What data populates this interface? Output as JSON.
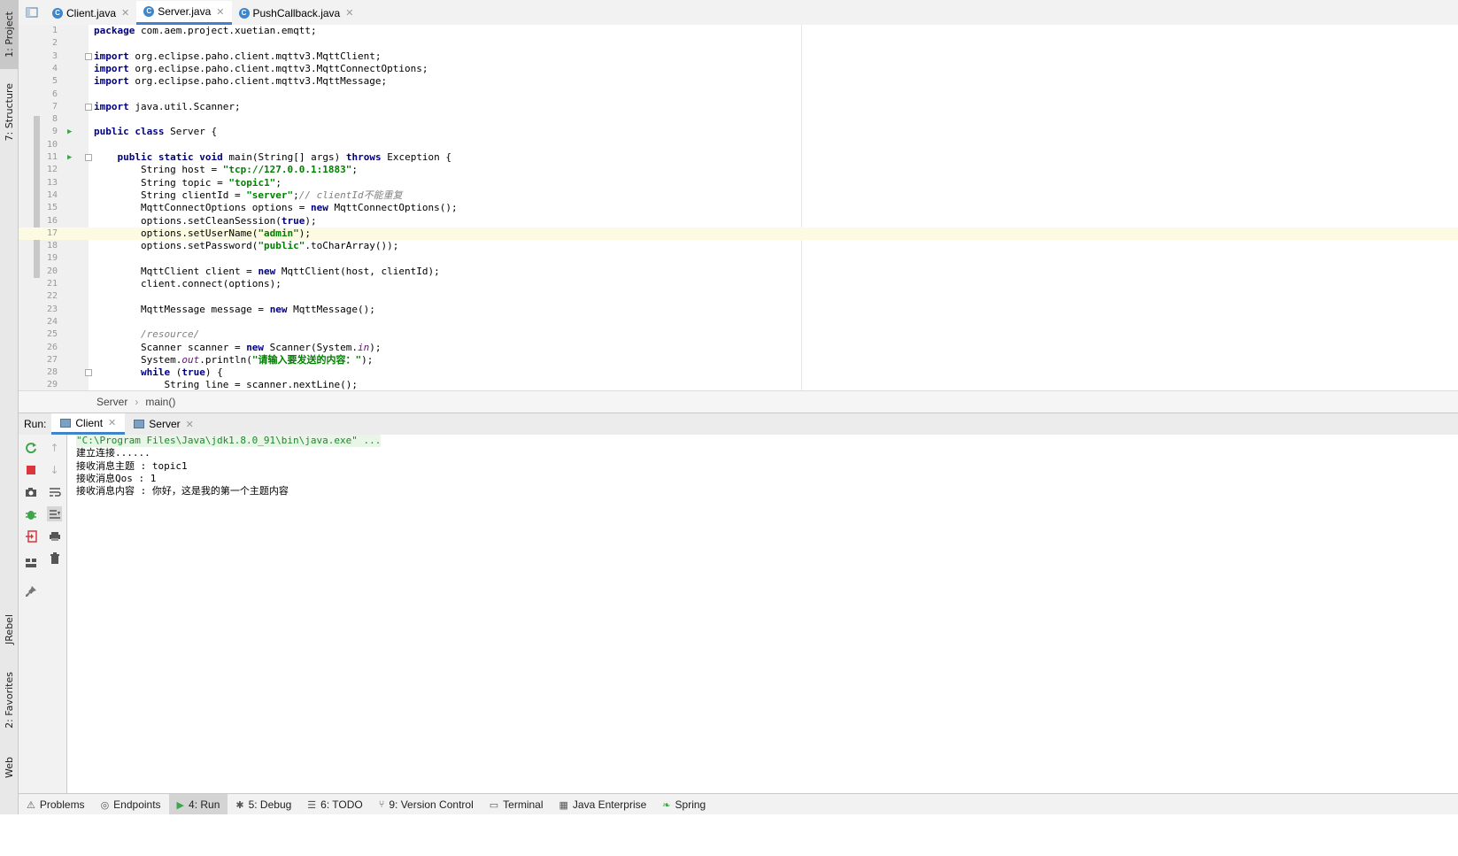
{
  "left_tool_tabs": [
    {
      "label": "1: Project",
      "icon": "folder-icon"
    },
    {
      "label": "7: Structure",
      "icon": "structure-icon"
    },
    {
      "label": "JRebel",
      "icon": "jrebel-icon"
    },
    {
      "label": "2: Favorites",
      "icon": "star-icon"
    },
    {
      "label": "Web",
      "icon": "globe-icon"
    }
  ],
  "editor_tabs": [
    {
      "label": "Client.java",
      "icon": "class-icon"
    },
    {
      "label": "Server.java",
      "icon": "class-icon",
      "active": true
    },
    {
      "label": "PushCallback.java",
      "icon": "class-icon"
    }
  ],
  "code_lines": [
    {
      "n": "1",
      "text": "package com.aem.project.xuetian.emqtt;"
    },
    {
      "n": "2",
      "text": ""
    },
    {
      "n": "3",
      "text": "import org.eclipse.paho.client.mqttv3.MqttClient;"
    },
    {
      "n": "4",
      "text": "import org.eclipse.paho.client.mqttv3.MqttConnectOptions;"
    },
    {
      "n": "5",
      "text": "import org.eclipse.paho.client.mqttv3.MqttMessage;"
    },
    {
      "n": "6",
      "text": ""
    },
    {
      "n": "7",
      "text": "import java.util.Scanner;"
    },
    {
      "n": "8",
      "text": ""
    },
    {
      "n": "9",
      "text": "public class Server {"
    },
    {
      "n": "10",
      "text": ""
    },
    {
      "n": "11",
      "text": "    public static void main(String[] args) throws Exception {"
    },
    {
      "n": "12",
      "text": "        String host = \"tcp://127.0.0.1:1883\";"
    },
    {
      "n": "13",
      "text": "        String topic = \"topic1\";"
    },
    {
      "n": "14",
      "text": "        String clientId = \"server\";// clientId不能重复"
    },
    {
      "n": "15",
      "text": "        MqttConnectOptions options = new MqttConnectOptions();"
    },
    {
      "n": "16",
      "text": "        options.setCleanSession(true);"
    },
    {
      "n": "17",
      "text": "        options.setUserName(\"admin\");"
    },
    {
      "n": "18",
      "text": "        options.setPassword(\"public\".toCharArray());"
    },
    {
      "n": "19",
      "text": ""
    },
    {
      "n": "20",
      "text": "        MqttClient client = new MqttClient(host, clientId);"
    },
    {
      "n": "21",
      "text": "        client.connect(options);"
    },
    {
      "n": "22",
      "text": ""
    },
    {
      "n": "23",
      "text": "        MqttMessage message = new MqttMessage();"
    },
    {
      "n": "24",
      "text": ""
    },
    {
      "n": "25",
      "text": "        /resource/"
    },
    {
      "n": "26",
      "text": "        Scanner scanner = new Scanner(System.in);"
    },
    {
      "n": "27",
      "text": "        System.out.println(\"请输入要发送的内容：\");"
    },
    {
      "n": "28",
      "text": "        while (true) {"
    },
    {
      "n": "29",
      "text": "            String line = scanner.nextLine();"
    }
  ],
  "breadcrumb": {
    "class_name": "Server",
    "method_name": "main()"
  },
  "run_panel": {
    "label": "Run:",
    "tabs": [
      {
        "label": "Client",
        "active": true
      },
      {
        "label": "Server"
      }
    ],
    "console_lines": [
      "\"C:\\Program Files\\Java\\jdk1.8.0_91\\bin\\java.exe\" ...",
      "建立连接......",
      "接收消息主题 : topic1",
      "接收消息Qos : 1",
      "接收消息内容 : 你好，这是我的第一个主题内容"
    ]
  },
  "status_bar": [
    {
      "label": "Problems",
      "icon": "warning-icon"
    },
    {
      "label": "Endpoints",
      "icon": "endpoints-icon"
    },
    {
      "label": "4: Run",
      "icon": "run-icon",
      "active": true
    },
    {
      "label": "5: Debug",
      "icon": "debug-icon"
    },
    {
      "label": "6: TODO",
      "icon": "todo-icon"
    },
    {
      "label": "9: Version Control",
      "icon": "vcs-icon"
    },
    {
      "label": "Terminal",
      "icon": "terminal-icon"
    },
    {
      "label": "Java Enterprise",
      "icon": "java-enterprise-icon"
    },
    {
      "label": "Spring",
      "icon": "spring-icon"
    }
  ],
  "colors": {
    "keyword": "#000080",
    "string": "#008000",
    "comment": "#808080",
    "accent": "#4083c9",
    "current_line": "#fcfae1"
  }
}
